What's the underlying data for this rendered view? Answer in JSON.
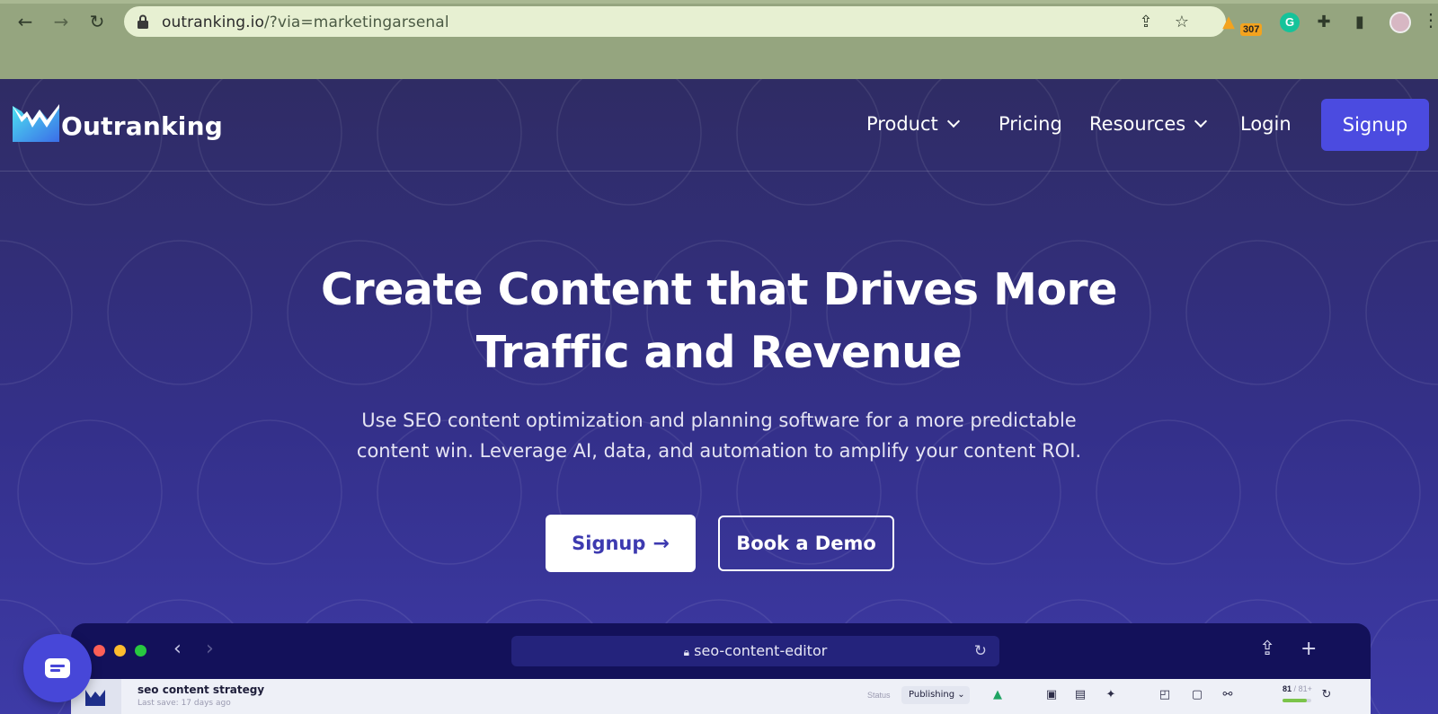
{
  "browser": {
    "url_host": "outranking.io",
    "url_path": "/?via=marketingarsenal",
    "extension_badge": "307",
    "grammarly_letter": "G"
  },
  "header": {
    "brand": "Outranking",
    "menu": [
      {
        "label": "Product",
        "has_dropdown": true
      },
      {
        "label": "Pricing",
        "has_dropdown": false
      },
      {
        "label": "Resources",
        "has_dropdown": true
      },
      {
        "label": "Login",
        "has_dropdown": false
      }
    ],
    "signup_label": "Signup"
  },
  "hero": {
    "title_line1": "Create Content that Drives More",
    "title_line2": "Traffic and Revenue",
    "subtitle_line1": "Use SEO content optimization and planning software for a more predictable",
    "subtitle_line2": "content win. Leverage AI, data, and automation to amplify your content ROI.",
    "signup_label": "Signup",
    "demo_label": "Book a Demo"
  },
  "mock_editor": {
    "url": "seo-content-editor",
    "doc_title": "seo content strategy",
    "last_save": "Last save:  17 days ago",
    "status_label": "Status",
    "status_value": "Publishing",
    "score": "81",
    "score_target": "81+",
    "score_fraction": 0.85
  },
  "colors": {
    "accent": "#4b4be0",
    "page_bg": "#2f2c64",
    "chrome_bg": "#95a57f"
  }
}
